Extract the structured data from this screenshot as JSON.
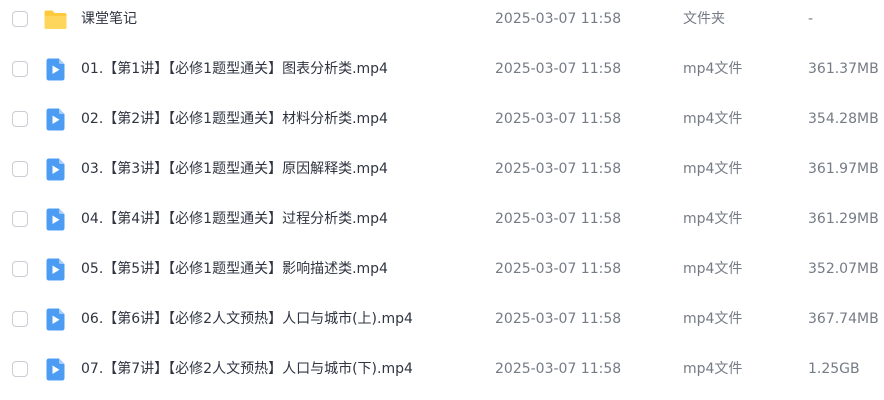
{
  "files": [
    {
      "name": "课堂笔记",
      "date": "2025-03-07 11:58",
      "type": "文件夹",
      "size": "-",
      "icon": "folder-icon"
    },
    {
      "name": "01.【第1讲】【必修1题型通关】图表分析类.mp4",
      "date": "2025-03-07 11:58",
      "type": "mp4文件",
      "size": "361.37MB",
      "icon": "video-file-icon"
    },
    {
      "name": "02.【第2讲】【必修1题型通关】材料分析类.mp4",
      "date": "2025-03-07 11:58",
      "type": "mp4文件",
      "size": "354.28MB",
      "icon": "video-file-icon"
    },
    {
      "name": "03.【第3讲】【必修1题型通关】原因解释类.mp4",
      "date": "2025-03-07 11:58",
      "type": "mp4文件",
      "size": "361.97MB",
      "icon": "video-file-icon"
    },
    {
      "name": "04.【第4讲】【必修1题型通关】过程分析类.mp4",
      "date": "2025-03-07 11:58",
      "type": "mp4文件",
      "size": "361.29MB",
      "icon": "video-file-icon"
    },
    {
      "name": "05.【第5讲】【必修1题型通关】影响描述类.mp4",
      "date": "2025-03-07 11:58",
      "type": "mp4文件",
      "size": "352.07MB",
      "icon": "video-file-icon"
    },
    {
      "name": "06.【第6讲】【必修2人文预热】人口与城市(上).mp4",
      "date": "2025-03-07 11:58",
      "type": "mp4文件",
      "size": "367.74MB",
      "icon": "video-file-icon"
    },
    {
      "name": "07.【第7讲】【必修2人文预热】人口与城市(下).mp4",
      "date": "2025-03-07 11:58",
      "type": "mp4文件",
      "size": "1.25GB",
      "icon": "video-file-icon"
    }
  ],
  "colors": {
    "folder": "#ffc93c",
    "video": "#4d9cf4",
    "text": "#2f3440",
    "muted": "#757b85",
    "checkbox_border": "#c9cdd4"
  }
}
